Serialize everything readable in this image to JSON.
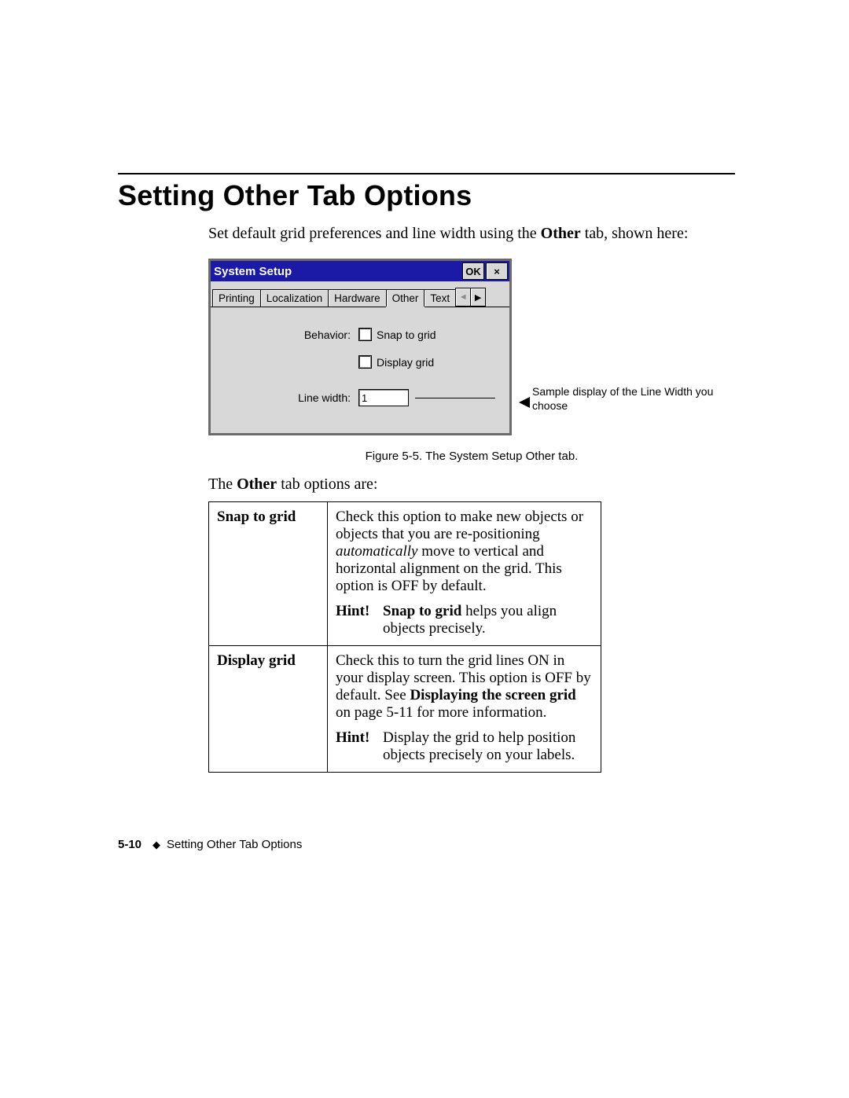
{
  "title": "Setting Other Tab Options",
  "intro_before_bold": "Set default grid preferences and line width using the ",
  "intro_bold": "Other",
  "intro_after_bold": " tab, shown here:",
  "window": {
    "title": "System Setup",
    "ok_label": "OK",
    "close_label": "×",
    "tabs": {
      "printing": "Printing",
      "localization": "Localization",
      "hardware": "Hardware",
      "other": "Other",
      "text": "Text",
      "nav_left": "◄",
      "nav_right": "▶"
    },
    "behavior_label": "Behavior:",
    "snap_to_grid_label": "Snap to grid",
    "display_grid_label": "Display grid",
    "line_width_label": "Line width:",
    "line_width_value": "1"
  },
  "callout": "Sample display of the Line Width you choose",
  "figure_caption": "Figure 5-5. The System Setup Other tab.",
  "lead_before_bold": "The ",
  "lead_bold": "Other",
  "lead_after_bold": " tab options are:",
  "options": {
    "snap": {
      "key": "Snap to grid",
      "desc_before_italic": "Check this option to make new objects or objects that you are re-positioning ",
      "desc_italic": "automatically",
      "desc_after_italic": " move to vertical and horizontal alignment on the grid. This option is OFF by default.",
      "hint_label": "Hint!",
      "hint_bold": "Snap to grid",
      "hint_after_bold": " helps you align objects precisely."
    },
    "display": {
      "key": "Display grid",
      "desc_before_bold": "Check this to turn the grid lines ON in your display screen. This option is OFF by default. See ",
      "desc_bold": "Displaying the screen grid",
      "desc_after_bold": " on page 5-11 for more information.",
      "hint_label": "Hint!",
      "hint_text": "Display the grid to help position objects precisely on your labels."
    }
  },
  "footer": {
    "page_number": "5-10",
    "diamond": "◆",
    "section": "Setting Other Tab Options"
  }
}
